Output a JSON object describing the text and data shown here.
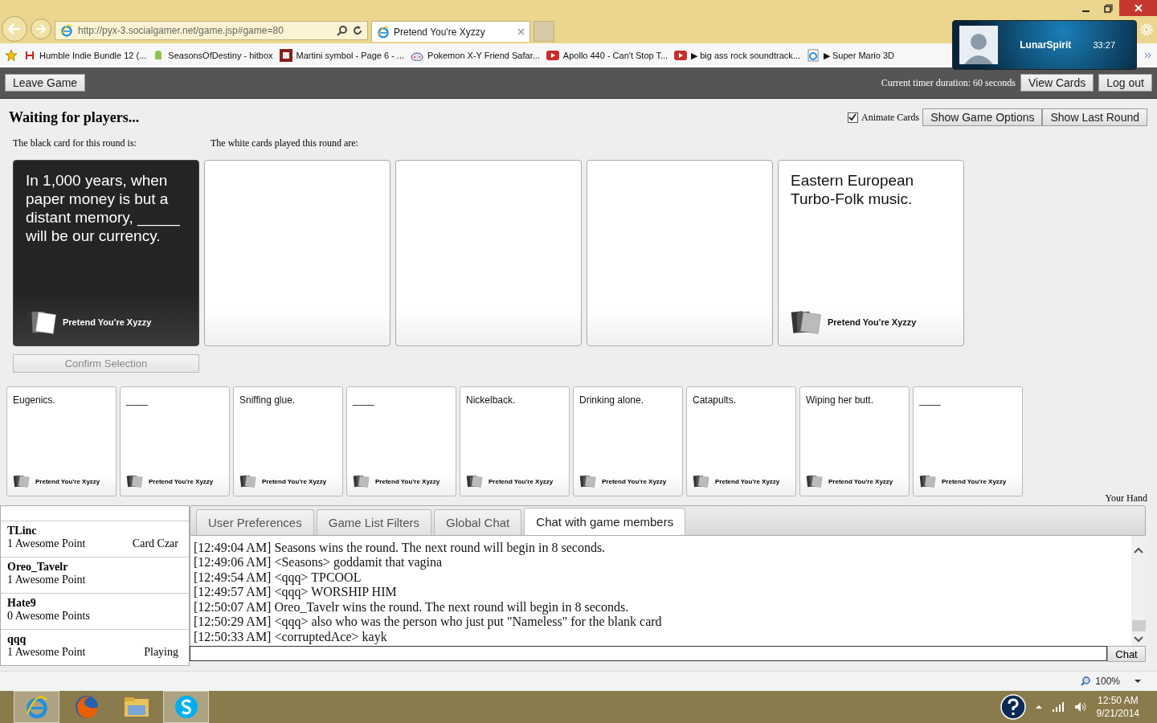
{
  "browser": {
    "address": "http://pyx-3.socialgamer.net/game.jsp#game=80",
    "tabs": [
      {
        "title": "Pretend You're Xyzzy",
        "selected": true
      }
    ],
    "bookmarks": [
      {
        "kind": "humble",
        "label": "Humble Indie Bundle 12 (..."
      },
      {
        "kind": "android",
        "label": "SeasonsOfDestiny - hitbox"
      },
      {
        "kind": "martini",
        "label": "Martini symbol - Page 6 - ..."
      },
      {
        "kind": "reddit",
        "label": "Pokemon X-Y Friend Safar..."
      },
      {
        "kind": "youtube",
        "label": "Apollo 440 - Can't Stop T..."
      },
      {
        "kind": "youtube",
        "label": "▶ big ass rock soundtrack..."
      },
      {
        "kind": "page",
        "label": "▶ Super Mario 3D"
      }
    ],
    "zoom": "100%"
  },
  "notification": {
    "name": "LunarSpirit",
    "time": "33:27"
  },
  "toolbar": {
    "leave": "Leave Game",
    "timer": "Current timer duration: 60 seconds",
    "buttons": [
      "View Cards",
      "Log out"
    ]
  },
  "game": {
    "status": "Waiting for players...",
    "animate_cards": {
      "label": "Animate Cards",
      "checked": true
    },
    "buttons": [
      "Show Game Options",
      "Show Last Round"
    ],
    "black_label": "The black card for this round is:",
    "white_label": "The white cards played this round are:",
    "black_card": {
      "text": "In 1,000 years, when paper money is but a distant memory, _____ will be our currency.",
      "brand": "Pretend You're Xyzzy"
    },
    "played_cards": [
      {
        "kind": "blank"
      },
      {
        "kind": "blank"
      },
      {
        "kind": "blank"
      },
      {
        "kind": "card",
        "text": "Eastern European Turbo-Folk music.",
        "brand": "Pretend You're Xyzzy"
      }
    ],
    "confirm": {
      "label": "Confirm Selection",
      "disabled": true
    }
  },
  "hand": {
    "label": "Your Hand",
    "cards": [
      {
        "text": "Eugenics.",
        "brand": "Pretend You're Xyzzy"
      },
      {
        "text": "____",
        "brand": "Pretend You're Xyzzy"
      },
      {
        "text": "Sniffing glue.",
        "brand": "Pretend You're Xyzzy"
      },
      {
        "text": "____",
        "brand": "Pretend You're Xyzzy"
      },
      {
        "text": "Nickelback.",
        "brand": "Pretend You're Xyzzy"
      },
      {
        "text": "Drinking alone.",
        "brand": "Pretend You're Xyzzy"
      },
      {
        "text": "Catapults.",
        "brand": "Pretend You're Xyzzy"
      },
      {
        "text": "Wiping her butt.",
        "brand": "Pretend You're Xyzzy"
      },
      {
        "text": "____",
        "brand": "Pretend You're Xyzzy"
      }
    ]
  },
  "players": [
    {
      "name": "TLinc",
      "score": "1 Awesome Point",
      "status": "Card Czar"
    },
    {
      "name": "Oreo_Tavelr",
      "score": "1 Awesome Point"
    },
    {
      "name": "Hate9",
      "score": "0 Awesome Points"
    },
    {
      "name": "qqq",
      "score": "1 Awesome Point",
      "status": "Playing"
    }
  ],
  "tabs": [
    {
      "label": "User Preferences",
      "selected": false
    },
    {
      "label": "Game List Filters",
      "selected": false
    },
    {
      "label": "Global Chat",
      "selected": false
    },
    {
      "label": "Chat with game members",
      "selected": true
    }
  ],
  "chat": {
    "lines": [
      "[12:49:04 AM] Seasons wins the round. The next round will begin in 8 seconds.",
      "[12:49:06 AM] <Seasons> goddamit that vagina",
      "[12:49:54 AM] <qqq> TPCOOL",
      "[12:49:57 AM] <qqq> WORSHIP HIM",
      "[12:50:07 AM] Oreo_Tavelr wins the round. The next round will begin in 8 seconds.",
      "[12:50:29 AM] <qqq> also who was the person who just put \"Nameless\" for the blank card",
      "[12:50:33 AM] <corruptedAce> kayk"
    ],
    "send": "Chat"
  },
  "taskbar": {
    "apps": [
      {
        "kind": "ie",
        "selected": true
      },
      {
        "kind": "firefox",
        "selected": false
      },
      {
        "kind": "folder",
        "selected": false
      },
      {
        "kind": "skype",
        "selected": true
      }
    ],
    "time": "12:50 AM",
    "date": "9/21/2014"
  }
}
